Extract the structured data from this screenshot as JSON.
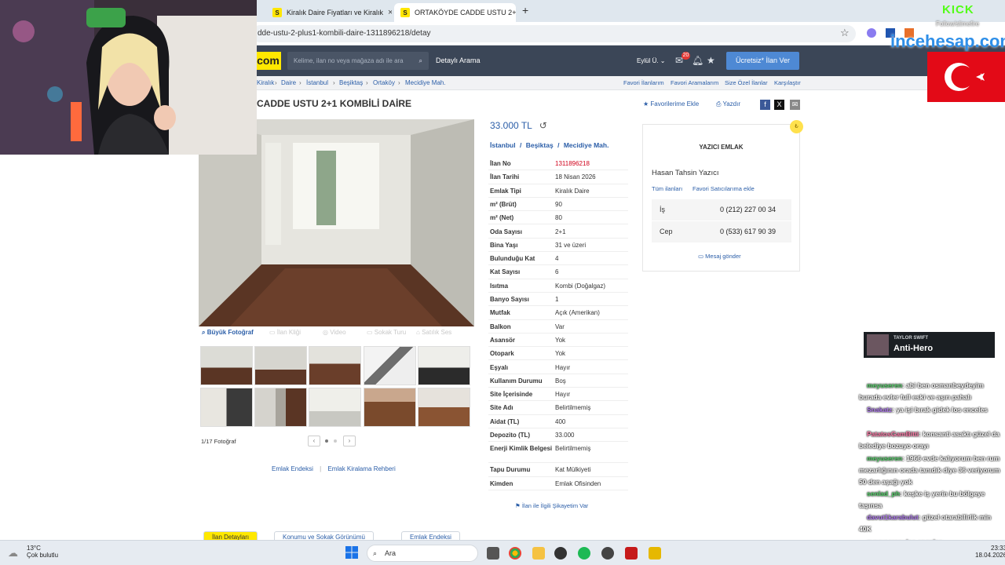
{
  "browser": {
    "tabs": [
      {
        "label": "Kiralık Daire Fiyatları ve Kiralık"
      },
      {
        "label": "ORTAKÖYDE CADDE USTU 2+1"
      }
    ],
    "new_tab": "+",
    "url": "dde-ustu-2-plus1-kombili-daire-1311896218/detay"
  },
  "site": {
    "logo": "com",
    "search_placeholder": "Kelime, ilan no veya mağaza adı ile ara",
    "detail_search": "Detaylı Arama",
    "user_menu": "Eylül Ü.",
    "message_badge": "20",
    "free_ad_button": "Ücretsiz* İlan Ver"
  },
  "breadcrumb": [
    "Kiralık",
    "Daire",
    "İstanbul",
    "Beşiktaş",
    "Ortaköy",
    "Mecidiye Mah."
  ],
  "utility_links": [
    "Favori İlanlarım",
    "Favori Aramalarım",
    "Size Özel İlanlar",
    "Karşılaştır"
  ],
  "listing": {
    "title": "CADDE USTU 2+1 KOMBİLİ DAİRE",
    "add_favorite": "Favorilerime Ekle",
    "print": "Yazdır",
    "price": "33.000 TL",
    "location": [
      "İstanbul",
      "Beşiktaş",
      "Mecidiye Mah."
    ],
    "photo_tabs": [
      "Büyük Fotoğraf",
      "İlan Kliği",
      "Video",
      "Sokak Turu",
      "Satılık Ses"
    ],
    "photo_count": "1/17 Fotoğraf",
    "bottom_links": [
      "Emlak Endeksi",
      "Emlak Kiralama Rehberi"
    ],
    "complaint": "İlan ile İlgili Şikayetim Var",
    "details": [
      {
        "key": "İlan No",
        "value": "1311896218",
        "highlight": true
      },
      {
        "key": "İlan Tarihi",
        "value": "18 Nisan 2026"
      },
      {
        "key": "Emlak Tipi",
        "value": "Kiralık Daire"
      },
      {
        "key": "m² (Brüt)",
        "value": "90"
      },
      {
        "key": "m² (Net)",
        "value": "80"
      },
      {
        "key": "Oda Sayısı",
        "value": "2+1"
      },
      {
        "key": "Bina Yaşı",
        "value": "31 ve üzeri"
      },
      {
        "key": "Bulunduğu Kat",
        "value": "4"
      },
      {
        "key": "Kat Sayısı",
        "value": "6"
      },
      {
        "key": "Isıtma",
        "value": "Kombi (Doğalgaz)"
      },
      {
        "key": "Banyo Sayısı",
        "value": "1"
      },
      {
        "key": "Mutfak",
        "value": "Açık (Amerikan)"
      },
      {
        "key": "Balkon",
        "value": "Var"
      },
      {
        "key": "Asansör",
        "value": "Yok"
      },
      {
        "key": "Otopark",
        "value": "Yok"
      },
      {
        "key": "Eşyalı",
        "value": "Hayır"
      },
      {
        "key": "Kullanım Durumu",
        "value": "Boş"
      },
      {
        "key": "Site İçerisinde",
        "value": "Hayır"
      },
      {
        "key": "Site Adı",
        "value": "Belirtilmemiş"
      },
      {
        "key": "Aidat (TL)",
        "value": "400"
      },
      {
        "key": "Depozito (TL)",
        "value": "33.000"
      },
      {
        "key": "Enerji Kimlik Belgesi",
        "value": "Belirtilmemiş"
      },
      {
        "key": "Tapu Durumu",
        "value": "Kat Mülkiyeti"
      },
      {
        "key": "Kimden",
        "value": "Emlak Ofisinden"
      }
    ],
    "bottom_tabs": [
      "İlan Detayları",
      "Konumu ve Sokak Görünümü",
      "Emlak Endeksi"
    ]
  },
  "seller": {
    "name": "YAZICI EMLAK",
    "person": "Hasan Tahsin Yazıcı",
    "all_ads": "Tüm ilanları",
    "add_favorite_seller": "Favori Satıcılarıma ekle",
    "phones": [
      {
        "label": "İş",
        "number": "0 (212) 227 00 34"
      },
      {
        "label": "Cep",
        "number": "0 (533) 617 90 39"
      }
    ],
    "send_message": "Mesaj gönder",
    "seal": "₺"
  },
  "stream": {
    "kick_logo": "KICK",
    "kick_sub": "Follow/slimefire",
    "sponsor": "incehesap.com",
    "now_playing_artist": "TAYLOR SWIFT",
    "now_playing_title": "Anti-Hero",
    "chat": [
      {
        "user": "meyuseren",
        "text": ": abi ben osmanbeydeyim burada evler full eski ve aşırı pahalı",
        "color": "#55d36a"
      },
      {
        "user": "Snakatz",
        "text": ": ya işi bırak gidek los enceles",
        "color": "#b07af0"
      },
      {
        "user": "PatatosGamBitti",
        "text": ": konsanti asaktı güzel da belediye bozuyo orayı",
        "color": "#ff7aa8"
      },
      {
        "user": "meyuseren",
        "text": ": 1966 evde kalıyorum ben rum mezarlığının orada tanıdık diye 36 veriyorum 50 den aşağı yok",
        "color": "#55d36a"
      },
      {
        "user": "senlad_ph",
        "text": ": keşke iş yerin bu bölgeye taşınsa",
        "color": "#55d36a"
      },
      {
        "user": "davut1karabulut",
        "text": ": güzel otarabilirlik min 40K",
        "color": "#b07af0"
      },
      {
        "user": "meyuseren",
        "text": ": los engeles",
        "color": "#55d36a"
      },
      {
        "user": "husrev",
        "text": ": 33 k mı istiyor buna bide",
        "color": "#4fa3ff"
      }
    ]
  },
  "taskbar": {
    "temperature": "13°C",
    "weather": "Çok bulutlu",
    "search": "Ara",
    "time": "23:33",
    "date": "18.04.2026"
  },
  "colors": {
    "header": "#3b4657",
    "accent_blue": "#2b5ea8",
    "logo_yellow": "#ffe800",
    "highlight_red": "#d0021b"
  }
}
